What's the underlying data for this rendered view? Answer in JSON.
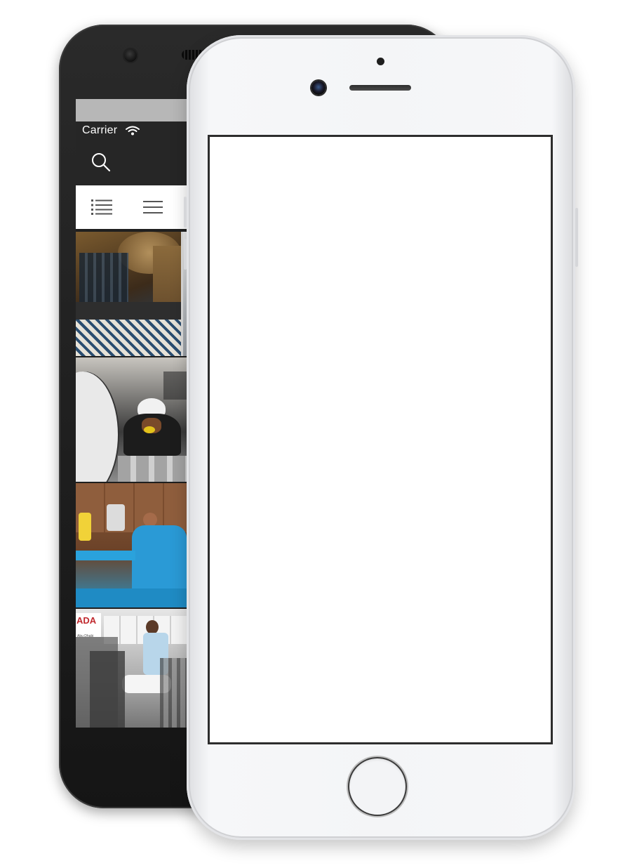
{
  "back_phone": {
    "status_bar": {
      "carrier": "Carrier"
    },
    "navbar": {
      "search_icon": "search-icon",
      "wifi_icon": "wifi-icon"
    },
    "tab_bar": {
      "icons": [
        "list-view-icon",
        "menu-icon"
      ]
    },
    "feed": [
      {
        "scene": "restaurant interior"
      },
      {
        "scene": "kitchen staff preparing food"
      },
      {
        "scene": "yoga class"
      },
      {
        "scene": "gym exercise bike",
        "badge_text": "ADA",
        "badge_subtext": "Abu Dhabi"
      }
    ]
  },
  "front_phone": {
    "screen": "blank"
  },
  "colors": {
    "black_phone_body": "#1c1c1c",
    "white_phone_body": "#f4f5f7",
    "navbar": "#262626",
    "tab_bar": "#ffffff"
  }
}
